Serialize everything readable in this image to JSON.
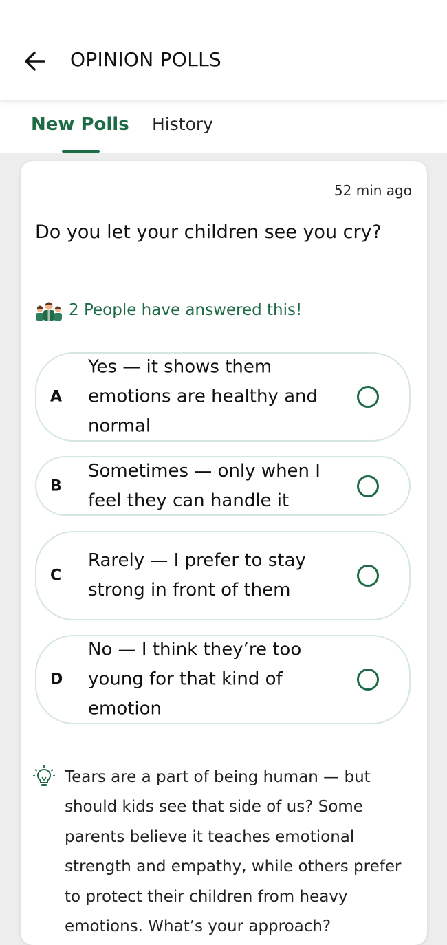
{
  "appbar": {
    "back_icon": "arrow-left-icon",
    "title": "OPINION POLLS"
  },
  "tabs": [
    {
      "label": "New Polls",
      "active": true
    },
    {
      "label": "History",
      "active": false
    }
  ],
  "colors": {
    "accent": "#1f6b45",
    "option_border": "#d6e6e0",
    "background": "#ededed"
  },
  "poll": {
    "timestamp": "52 min ago",
    "question": "Do you let your children see you cry?",
    "people_icon": "people-group-icon",
    "answered_text": "2 People have answered this!",
    "options": [
      {
        "letter": "A",
        "text": "Yes — it shows them emotions are healthy and normal",
        "selected": false
      },
      {
        "letter": "B",
        "text": "Sometimes — only when I feel they can handle it",
        "selected": false
      },
      {
        "letter": "C",
        "text": "Rarely — I prefer to stay strong in front of them",
        "selected": false
      },
      {
        "letter": "D",
        "text": "No — I think they’re too young for that kind of emotion",
        "selected": false
      }
    ],
    "tip_icon": "lightbulb-icon",
    "tip_text": "Tears are a part of being human — but should kids see that side of us? Some parents believe it teaches emotional strength and empathy, while others prefer to protect their children from heavy emotions. What’s your approach?"
  }
}
